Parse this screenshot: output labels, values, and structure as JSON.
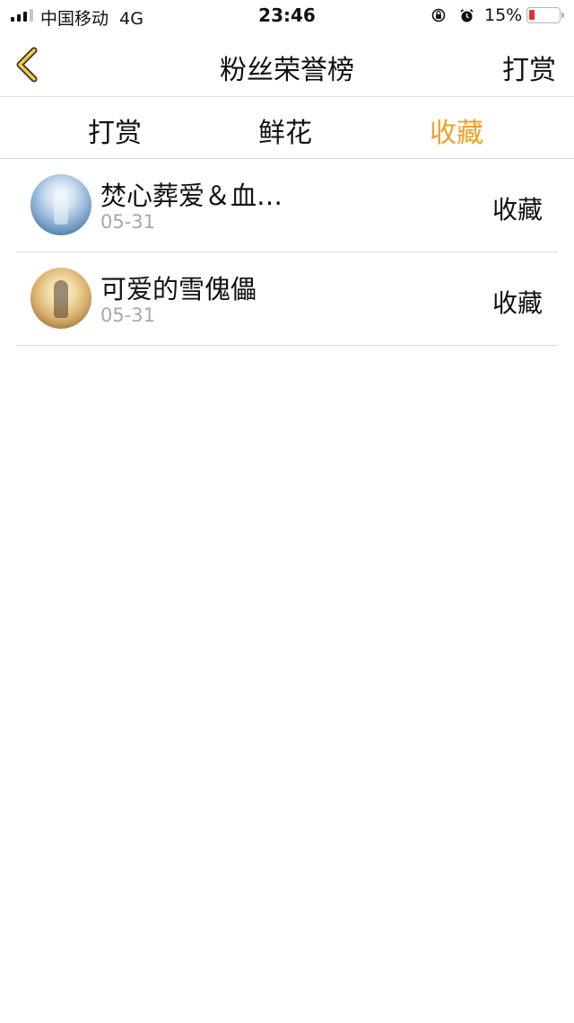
{
  "status_bar": {
    "carrier": "中国移动",
    "network": "4G",
    "time": "23:46",
    "battery_percent": "15%"
  },
  "nav": {
    "title": "粉丝荣誉榜",
    "action_label": "打赏",
    "accent_color": "#e6a23c"
  },
  "tabs": [
    {
      "label": "打赏",
      "active": false
    },
    {
      "label": "鲜花",
      "active": false
    },
    {
      "label": "收藏",
      "active": true
    }
  ],
  "colors": {
    "active_tab": "#f0a02a",
    "date_text": "#a8a8a8",
    "divider": "#dcdcdc"
  },
  "list": [
    {
      "name": "焚心葬爱＆血…",
      "date": "05-31",
      "type": "收藏"
    },
    {
      "name": "可爱的雪傀儡",
      "date": "05-31",
      "type": "收藏"
    }
  ]
}
